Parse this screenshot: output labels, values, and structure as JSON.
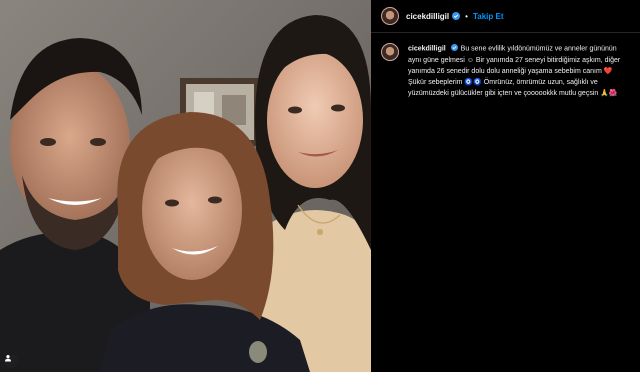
{
  "post": {
    "username": "cicekdilligil",
    "follow_label": "Takip Et",
    "separator": "•",
    "caption_parts": [
      "Bu sene evlilik yıldönümümüz ve anneler gününün aynı güne gelmesi ",
      "☺",
      " Bir yanımda 27 seneyi bitirdiğimiz aşkım, diğer yanımda 26 senedir dolu dolu anneliği yaşama sebebim canım ",
      "❤️",
      " Şükür sebeplerim ",
      "🧿🧿",
      " Ömrünüz, ömrümüz uzun, sağlıklı ve yüzümüzdeki gülücükler gibi içten ve çoooookkk mutlu geçsin ",
      "🙏🌺"
    ]
  },
  "icons": {
    "verified": "verified-badge-icon",
    "tag": "user-tag-icon"
  },
  "colors": {
    "background": "#000000",
    "link": "#0095f6",
    "verified": "#3897f0",
    "divider": "#262626"
  }
}
